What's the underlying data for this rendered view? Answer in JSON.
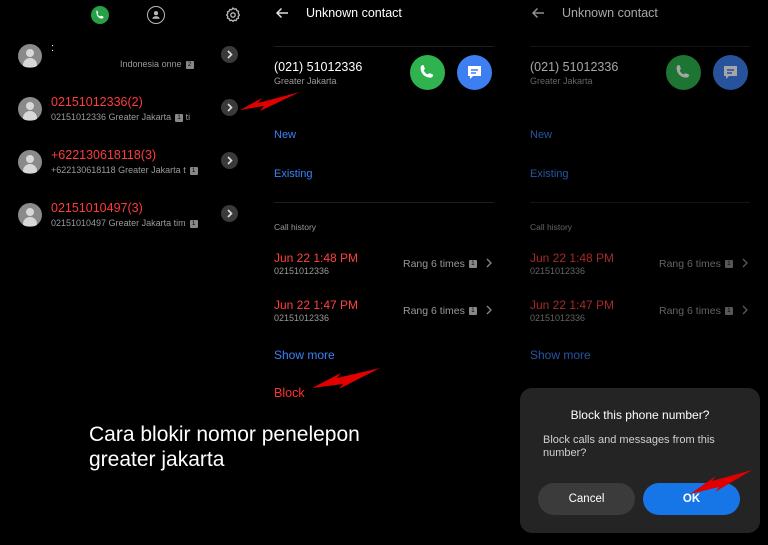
{
  "recents": {
    "tabs": [
      "phone-icon",
      "contacts-icon",
      "settings-icon"
    ],
    "items": [
      {
        "name": ":",
        "detail": "Indonesia",
        "tail": "onne",
        "sim": "2",
        "title_color": "white"
      },
      {
        "name": "02151012336(2)",
        "detail": "02151012336 Greater Jakarta",
        "tail": "ti",
        "sim": "1",
        "title_color": "red"
      },
      {
        "name": "+622130618118(3)",
        "detail": "+622130618118 Greater Jakarta",
        "tail": "t",
        "sim": "1",
        "title_color": "red"
      },
      {
        "name": "02151010497(3)",
        "detail": "02151010497 Greater Jakarta",
        "tail": "tim",
        "sim": "1",
        "title_color": "red"
      }
    ]
  },
  "caption": {
    "line1": "Cara blokir nomor penelepon",
    "line2": "greater jakarta"
  },
  "detail": {
    "title": "Unknown contact",
    "number": "(021) 51012336",
    "region": "Greater Jakarta",
    "new_label": "New",
    "existing_label": "Existing",
    "call_history_label": "Call history",
    "history": [
      {
        "date": "Jun 22 1:48 PM",
        "number": "02151012336",
        "status": "Rang 6 times",
        "sim": "1"
      },
      {
        "date": "Jun 22 1:47 PM",
        "number": "02151012336",
        "status": "Rang 6 times",
        "sim": "1"
      }
    ],
    "show_more": "Show more",
    "block": "Block"
  },
  "dialog": {
    "title": "Block this phone number?",
    "message": "Block calls and messages from this number?",
    "cancel": "Cancel",
    "ok": "OK"
  },
  "colors": {
    "missed": "#ff3b3b",
    "link": "#3b82f6",
    "call_button": "#2fb34e",
    "message_button": "#3d7ff0",
    "ok_button": "#1676e8",
    "annotation_arrow": "#e00000"
  }
}
